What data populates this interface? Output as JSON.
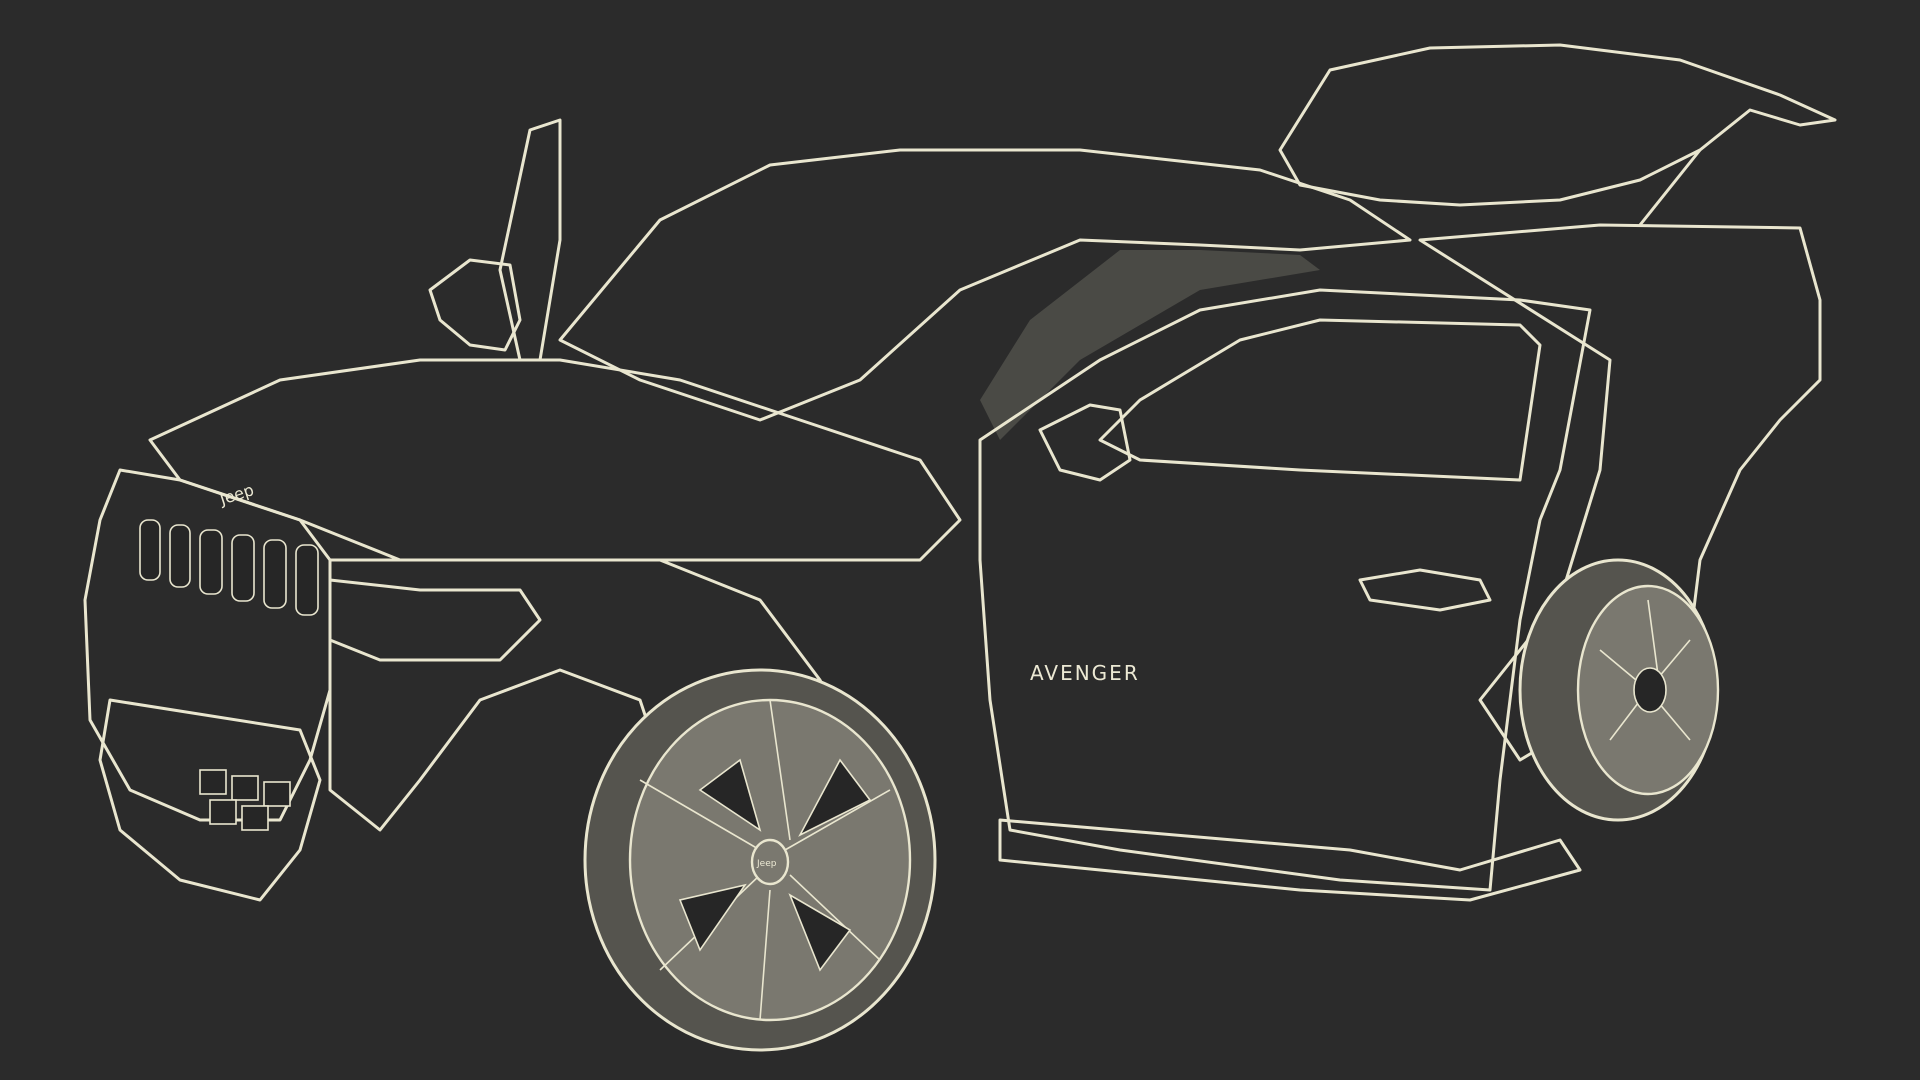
{
  "scene": {
    "subject": "car-wireframe-render",
    "background_color": "#2b2b2b",
    "wire_color": "#e9e6cf",
    "surface_color": "#6f6e66"
  },
  "labels": {
    "grille_logo": "Jeep",
    "door_badge": "AVENGER",
    "hub_logo": "Jeep"
  }
}
